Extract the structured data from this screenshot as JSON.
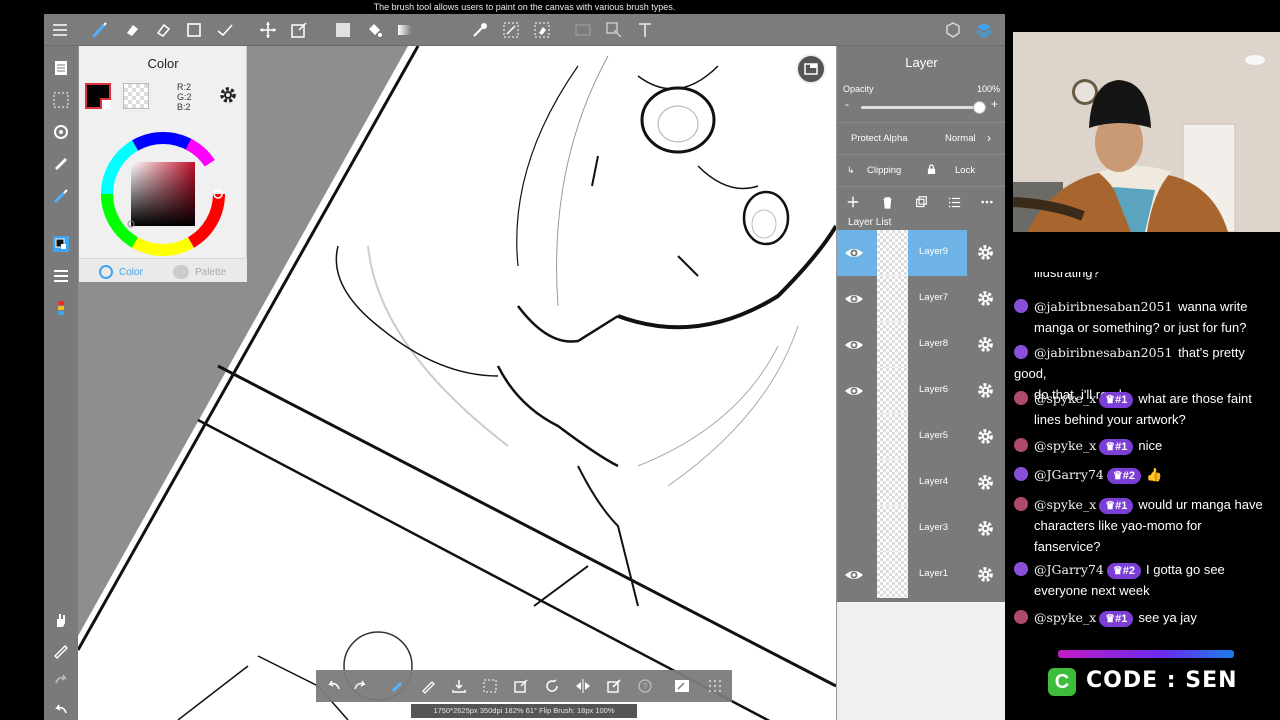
{
  "tooltip": "The brush tool allows users to paint on the canvas with various brush types.",
  "color_panel": {
    "title": "Color",
    "rgb": {
      "r": "R:2",
      "g": "G:2",
      "b": "B:2"
    },
    "foreground_color": "#020202",
    "tabs": [
      {
        "label": "Color"
      },
      {
        "label": "Palette"
      }
    ]
  },
  "layer_panel": {
    "title": "Layer",
    "opacity_label": "Opacity",
    "opacity_value": "100%",
    "opacity_fraction": 1.0,
    "protect_alpha_label": "Protect Alpha",
    "blend_mode": "Normal",
    "clipping_label": "Clipping",
    "lock_label": "Lock",
    "list_label": "Layer List",
    "layers": [
      {
        "name": "Layer9",
        "visible": true,
        "active": true
      },
      {
        "name": "Layer7",
        "visible": true,
        "active": false
      },
      {
        "name": "Layer8",
        "visible": true,
        "active": false
      },
      {
        "name": "Layer6",
        "visible": true,
        "active": false
      },
      {
        "name": "Layer5",
        "visible": false,
        "active": false
      },
      {
        "name": "Layer4",
        "visible": false,
        "active": false
      },
      {
        "name": "Layer3",
        "visible": false,
        "active": false
      },
      {
        "name": "Layer1",
        "visible": true,
        "active": false
      }
    ]
  },
  "status_bar": "1750*2625px 350dpi 182% 61° Flip Brush: 18px 100%",
  "chat": {
    "messages": [
      {
        "user": "",
        "badge": "",
        "text": "illustrating?",
        "avatar": ""
      },
      {
        "user": "@jabiribnesaban2051",
        "badge": "",
        "text": "wanna write",
        "cont": "manga or something? or just for fun?",
        "avatar": "#8a4fd8"
      },
      {
        "user": "@jabiribnesaban2051",
        "badge": "",
        "text": "that's pretty good,",
        "cont": "do that, i'll read.",
        "avatar": "#8a4fd8"
      },
      {
        "user": "@spyke_x",
        "badge": "#1",
        "text": "what are those faint",
        "cont": "lines behind your artwork?",
        "avatar": "#b04a6a"
      },
      {
        "user": "@spyke_x",
        "badge": "#1",
        "text": "nice",
        "avatar": "#b04a6a"
      },
      {
        "user": "@JGarry74",
        "badge": "#2",
        "text": "👍",
        "avatar": "#8a4fd8"
      },
      {
        "user": "@spyke_x",
        "badge": "#1",
        "text": "would ur manga have",
        "cont": "characters like yao-momo for",
        "cont2": "fanservice?",
        "avatar": "#b04a6a"
      },
      {
        "user": "@JGarry74",
        "badge": "#2",
        "text": "I gotta go see",
        "cont": "everyone next week",
        "avatar": "#8a4fd8"
      },
      {
        "user": "@spyke_x",
        "badge": "#1",
        "text": "see ya jay",
        "avatar": "#b04a6a"
      }
    ]
  },
  "code_banner": {
    "icon_letter": "C",
    "text": "CODE : SEN"
  },
  "colors": {
    "accent_blue": "#6eb3e6",
    "badge_purple": "#7b3fd6",
    "code_green": "#3dbd3b"
  }
}
